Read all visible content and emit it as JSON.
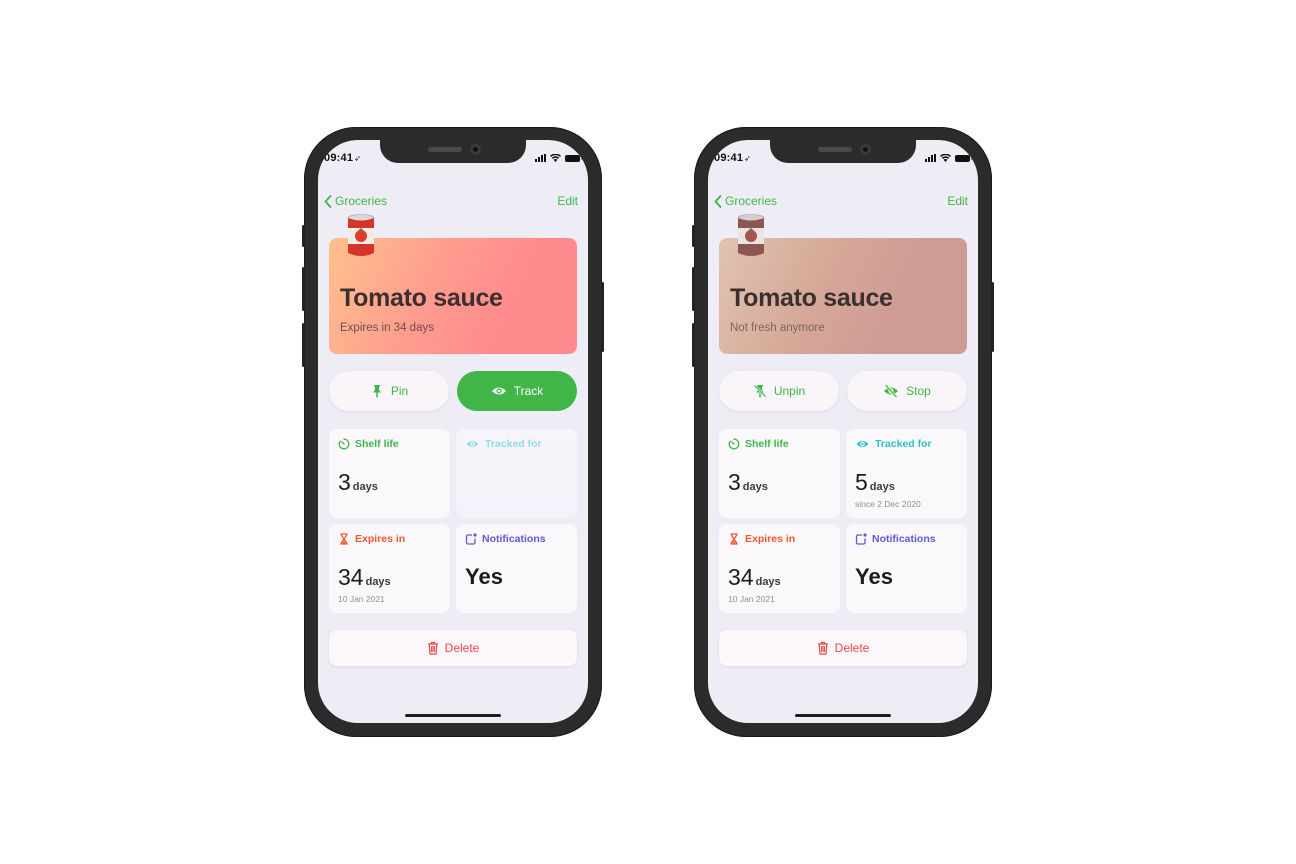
{
  "theme": {
    "accent": "#3fb548",
    "cyan": "#28c4c9",
    "orange": "#f2552c",
    "indigo": "#5b5bd6",
    "danger": "#ef4444"
  },
  "screens": [
    {
      "status": {
        "time": "09:41",
        "location_icon": "location-arrow-icon"
      },
      "nav": {
        "back_label": "Groceries",
        "edit_label": "Edit"
      },
      "hero": {
        "emoji": "canned-food-icon",
        "title": "Tomato sauce",
        "subtitle": "Expires in 34 days",
        "state": "fresh"
      },
      "actions": [
        {
          "label": "Pin",
          "icon": "pin-icon",
          "style": "secondary"
        },
        {
          "label": "Track",
          "icon": "eye-icon",
          "style": "primary"
        }
      ],
      "cards": {
        "shelf_life": {
          "label": "Shelf life",
          "icon": "timer-icon",
          "value": "3",
          "unit": "days",
          "note": ""
        },
        "tracked_for": {
          "label": "Tracked for",
          "icon": "eye-icon",
          "value": "",
          "unit": "",
          "note": "",
          "disabled": true
        },
        "expires_in": {
          "label": "Expires in",
          "icon": "hourglass-icon",
          "value": "34",
          "unit": "days",
          "note": "10 Jan 2021"
        },
        "notifications": {
          "label": "Notifications",
          "icon": "app-badge-icon",
          "value": "Yes"
        }
      },
      "delete_label": "Delete"
    },
    {
      "status": {
        "time": "09:41",
        "location_icon": "location-arrow-icon"
      },
      "nav": {
        "back_label": "Groceries",
        "edit_label": "Edit"
      },
      "hero": {
        "emoji": "canned-food-icon",
        "title": "Tomato sauce",
        "subtitle": "Not fresh anymore",
        "state": "stale"
      },
      "actions": [
        {
          "label": "Unpin",
          "icon": "pin-slash-icon",
          "style": "secondary"
        },
        {
          "label": "Stop",
          "icon": "eye-slash-icon",
          "style": "secondary"
        }
      ],
      "cards": {
        "shelf_life": {
          "label": "Shelf life",
          "icon": "timer-icon",
          "value": "3",
          "unit": "days",
          "note": ""
        },
        "tracked_for": {
          "label": "Tracked for",
          "icon": "eye-icon",
          "value": "5",
          "unit": "days",
          "note": "since 2 Dec 2020",
          "disabled": false
        },
        "expires_in": {
          "label": "Expires in",
          "icon": "hourglass-icon",
          "value": "34",
          "unit": "days",
          "note": "10 Jan 2021"
        },
        "notifications": {
          "label": "Notifications",
          "icon": "app-badge-icon",
          "value": "Yes"
        }
      },
      "delete_label": "Delete"
    }
  ]
}
